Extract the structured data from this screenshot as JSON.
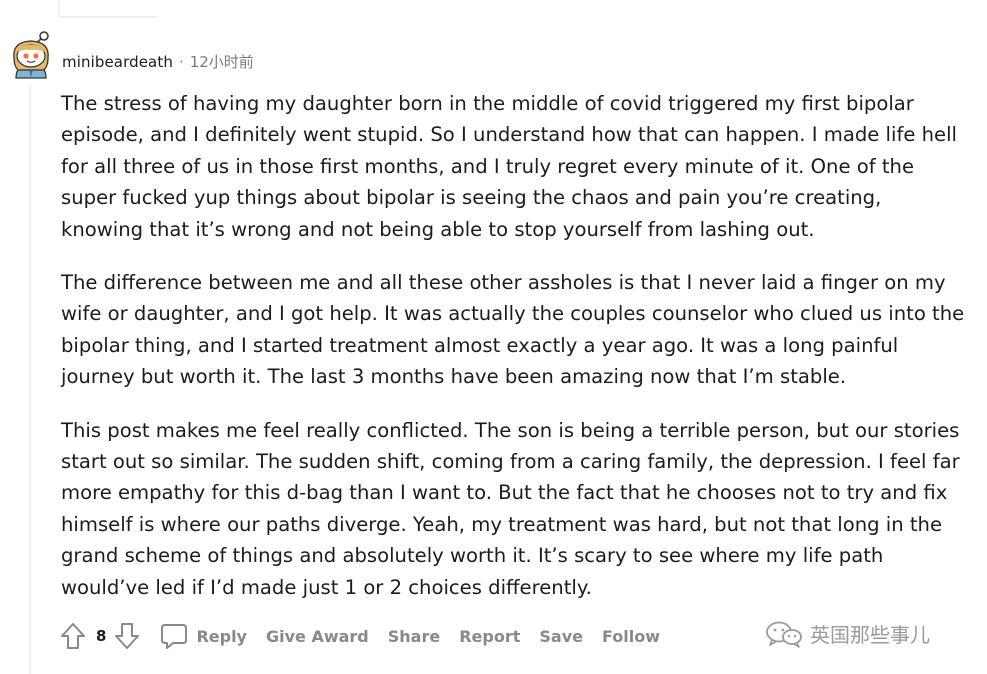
{
  "comment": {
    "username": "minibeardeath",
    "separator": "·",
    "timestamp": "12小时前",
    "paragraphs": [
      "The stress of having my daughter born in the middle of covid triggered my first bipolar episode, and I definitely went stupid. So I understand how that can happen. I made life hell for all three of us in those first months, and I truly regret every minute of it. One of the super fucked yup things about bipolar is seeing the chaos and pain you’re creating, knowing that it’s wrong and not being able to stop yourself from lashing out.",
      "The difference between me and all these other assholes is that I never laid a finger on my wife or daughter, and I got help. It was actually the couples counselor who clued us into the bipolar thing, and I started treatment almost exactly a year ago. It was a long painful journey but worth it. The last 3 months have been amazing now that I’m stable.",
      "This post makes me feel really conflicted. The son is being a terrible person, but our stories start out so similar. The sudden shift, coming from a caring family, the depression. I feel far more empathy for this d-bag than I want to. But the fact that he chooses not to try and fix himself is where our paths diverge. Yeah, my treatment was hard, but not that long in the grand scheme of things and absolutely worth it. It’s scary to see where my life path would’ve led if I’d made just 1 or 2 choices differently."
    ],
    "score": "8"
  },
  "actions": {
    "reply": "Reply",
    "give_award": "Give Award",
    "share": "Share",
    "report": "Report",
    "save": "Save",
    "follow": "Follow"
  },
  "watermark": {
    "text": "英国那些事儿"
  },
  "icons": {
    "upvote": "upvote-arrow-icon",
    "downvote": "downvote-arrow-icon",
    "reply": "speech-bubble-icon",
    "watermark": "wechat-logo-icon"
  },
  "colors": {
    "text": "#1c1c1c",
    "meta": "#7c7c7c",
    "action": "#878a8c",
    "thread_line": "#edeff1"
  }
}
